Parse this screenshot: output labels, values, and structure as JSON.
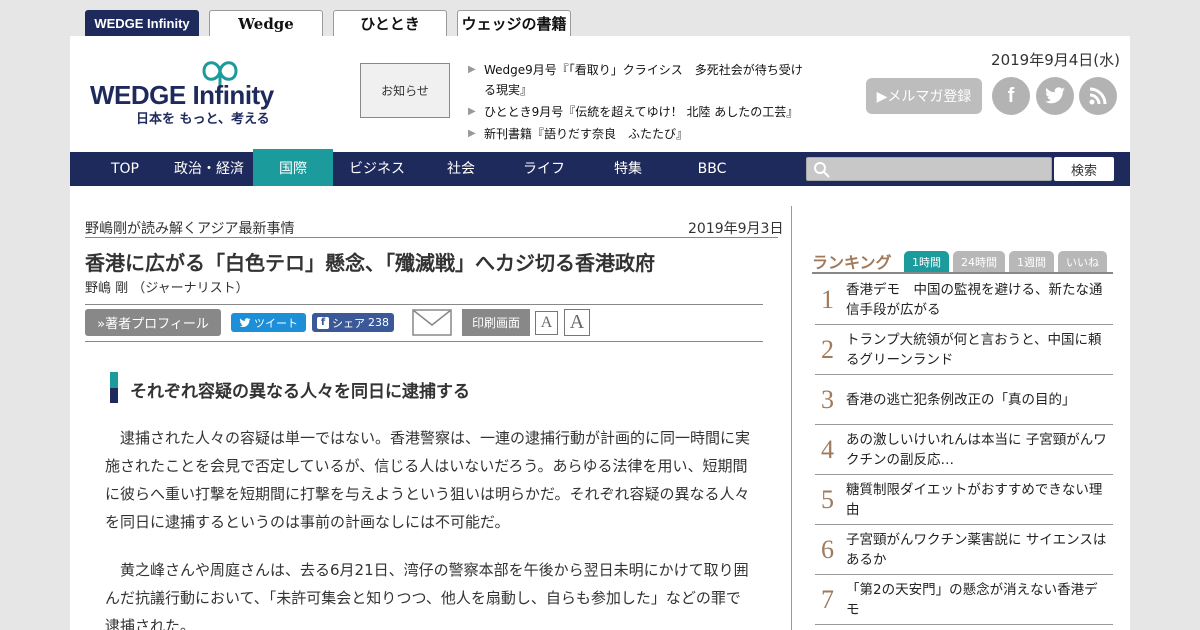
{
  "site_tabs": [
    "WEDGE Infinity",
    "Wedge",
    "ひととき",
    "ウェッジの書籍"
  ],
  "logo": {
    "main": "WEDGE Infinity",
    "sub": "日本を もっと、考える"
  },
  "notice": {
    "label": "お知らせ",
    "items": [
      "Wedge9月号『「看取り」クライシス　多死社会が待ち受ける現実』",
      "ひととき9月号『伝統を超えてゆけ！ 北陸 あしたの工芸』",
      "新刊書籍『語りだす奈良　ふたたび』"
    ]
  },
  "header_date": "2019年9月4日(水)",
  "mailmag_label": "▶メルマガ登録",
  "social_icons": [
    "facebook-icon",
    "twitter-icon",
    "rss-icon"
  ],
  "nav": {
    "items": [
      "TOP",
      "政治・経済",
      "国際",
      "ビジネス",
      "社会",
      "ライフ",
      "特集",
      "BBC"
    ],
    "active": "国際",
    "search_button": "検索"
  },
  "article": {
    "series": "野嶋剛が読み解くアジア最新事情",
    "date": "2019年9月3日",
    "title": "香港に広がる「白色テロ」懸念、「殲滅戦」へカジ切る香港政府",
    "author": "野嶋 剛 （ジャーナリスト）",
    "toolbar": {
      "profile": "»著者プロフィール",
      "tweet": "ツイート",
      "share": "シェア",
      "share_count": "238",
      "print": "印刷画面",
      "font_small": "A",
      "font_large": "A"
    },
    "subheading": "それぞれ容疑の異なる人々を同日に逮捕する",
    "paragraphs": [
      "　逮捕された人々の容疑は単一ではない。香港警察は、一連の逮捕行動が計画的に同一時間に実施されたことを会見で否定しているが、信じる人はいないだろう。あらゆる法律を用い、短期間に彼らへ重い打撃を短期間に打撃を与えようという狙いは明らかだ。それぞれ容疑の異なる人々を同日に逮捕するというのは事前の計画なしには不可能だ。",
      "　黄之峰さんや周庭さんは、去る6月21日、湾仔の警察本部を午後から翌日未明にかけて取り囲んだ抗議行動において、「未許可集会と知りつつ、他人を扇動し、自らも参加した」などの罪で逮捕された。"
    ]
  },
  "ranking": {
    "title": "ランキング",
    "tabs": [
      "1時間",
      "24時間",
      "1週間",
      "いいね"
    ],
    "active_tab": "1時間",
    "items": [
      {
        "rank": "1",
        "text": "香港デモ　中国の監視を避ける、新たな通信手段が広がる"
      },
      {
        "rank": "2",
        "text": "トランプ大統領が何と言おうと、中国に頼るグリーンランド"
      },
      {
        "rank": "3",
        "text": "香港の逃亡犯条例改正の「真の目的」"
      },
      {
        "rank": "4",
        "text": "あの激しいけいれんは本当に 子宮頸がんワクチンの副反応…"
      },
      {
        "rank": "5",
        "text": "糖質制限ダイエットがおすすめできない理由"
      },
      {
        "rank": "6",
        "text": "子宮頸がんワクチン薬害説に サイエンスはあるか"
      },
      {
        "rank": "7",
        "text": "「第2の天安門」の懸念が消えない香港デモ"
      }
    ]
  },
  "colors": {
    "navy": "#1f2a5c",
    "teal": "#1b9b9b",
    "rank_brown": "#a07a5a"
  }
}
